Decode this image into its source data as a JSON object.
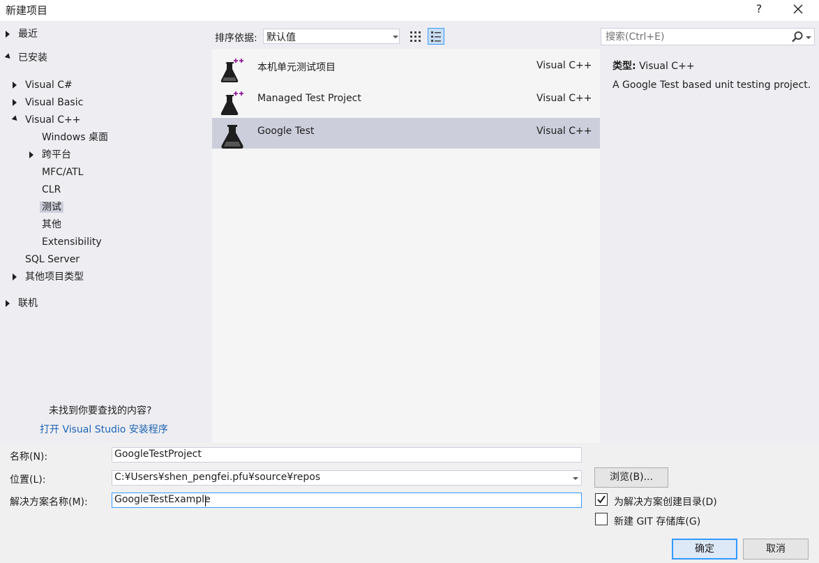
{
  "window": {
    "title": "新建项目",
    "help": "?"
  },
  "tree": {
    "recent": "最近",
    "installed": "已安装",
    "visual_csharp": "Visual C#",
    "visual_basic": "Visual Basic",
    "visual_cpp": "Visual C++",
    "windows_desktop": "Windows 桌面",
    "cross_platform": "跨平台",
    "mfc_atl": "MFC/ATL",
    "clr": "CLR",
    "test": "测试",
    "other": "其他",
    "extensibility": "Extensibility",
    "sql_server": "SQL Server",
    "other_project_types": "其他项目类型",
    "online": "联机",
    "not_found": "未找到你要查找的内容?",
    "installer_link": "打开 Visual Studio 安装程序"
  },
  "sort": {
    "label": "排序依据:",
    "value": "默认值"
  },
  "search": {
    "placeholder": "搜索(Ctrl+E)"
  },
  "projects": [
    {
      "name": "本机单元测试项目",
      "lang": "Visual C++",
      "icon": "flask-plus-icon",
      "selected": false
    },
    {
      "name": "Managed Test Project",
      "lang": "Visual C++",
      "icon": "flask-plus-icon",
      "selected": false
    },
    {
      "name": "Google Test",
      "lang": "Visual C++",
      "icon": "flask-icon",
      "selected": true
    }
  ],
  "info": {
    "type_label": "类型:",
    "type_value": "Visual C++",
    "description": "A Google Test based unit testing project."
  },
  "form": {
    "name_label": "名称(N):",
    "name_value": "GoogleTestProject",
    "location_label": "位置(L):",
    "location_value": "C:¥Users¥shen_pengfei.pfu¥source¥repos",
    "solution_label": "解决方案名称(M):",
    "solution_value": "GoogleTestExample",
    "browse": "浏览(B)...",
    "create_dir": "为解决方案创建目录(D)",
    "create_dir_checked": true,
    "new_git": "新建 GIT 存储库(G)",
    "new_git_checked": false,
    "ok": "确定",
    "cancel": "取消"
  },
  "colors": {
    "accent": "#3399ff",
    "selection": "#cccedb",
    "link": "#1e63b3",
    "flask_plus": "#9b2da0"
  }
}
